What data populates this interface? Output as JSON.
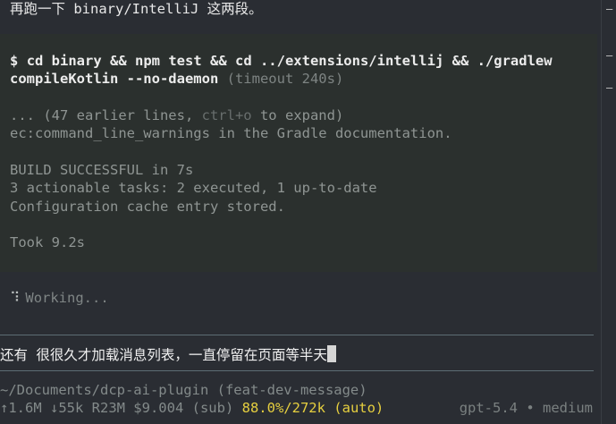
{
  "conversation": {
    "assistant_message": "再跑一下 binary/IntelliJ 这两段。",
    "command": {
      "prompt": "$",
      "line1": "cd binary && npm test && cd ../extensions/intellij && ./gradlew",
      "line2": "compileKotlin --no-daemon",
      "timeout": "(timeout 240s)"
    },
    "output": {
      "collapsed_prefix": "... (47 earlier lines, ",
      "collapsed_key": "ctrl+o",
      "collapsed_suffix": " to expand)",
      "lines": [
        "ec:command_line_warnings in the Gradle documentation.",
        "",
        "BUILD SUCCESSFUL in 7s",
        "3 actionable tasks: 2 executed, 1 up-to-date",
        "Configuration cache entry stored.",
        "",
        "Took 9.2s"
      ]
    },
    "status": {
      "spinner": "⠹",
      "text": "Working..."
    }
  },
  "input": {
    "value": "还有 很很久才加载消息列表，一直停留在页面等半天"
  },
  "footer": {
    "cwd": "~/Documents/dcp-ai-plugin (feat-dev-message)",
    "stats": "↑1.6M ↓55k R23M $9.004 (sub) ",
    "context": "88.0%/272k (auto)",
    "model": "gpt-5.4 • medium"
  },
  "colors": {
    "background": "#2a2d33",
    "command_block": "#2b302e",
    "context_warning": "#e6cf3f",
    "rule": "#5d6d74"
  }
}
